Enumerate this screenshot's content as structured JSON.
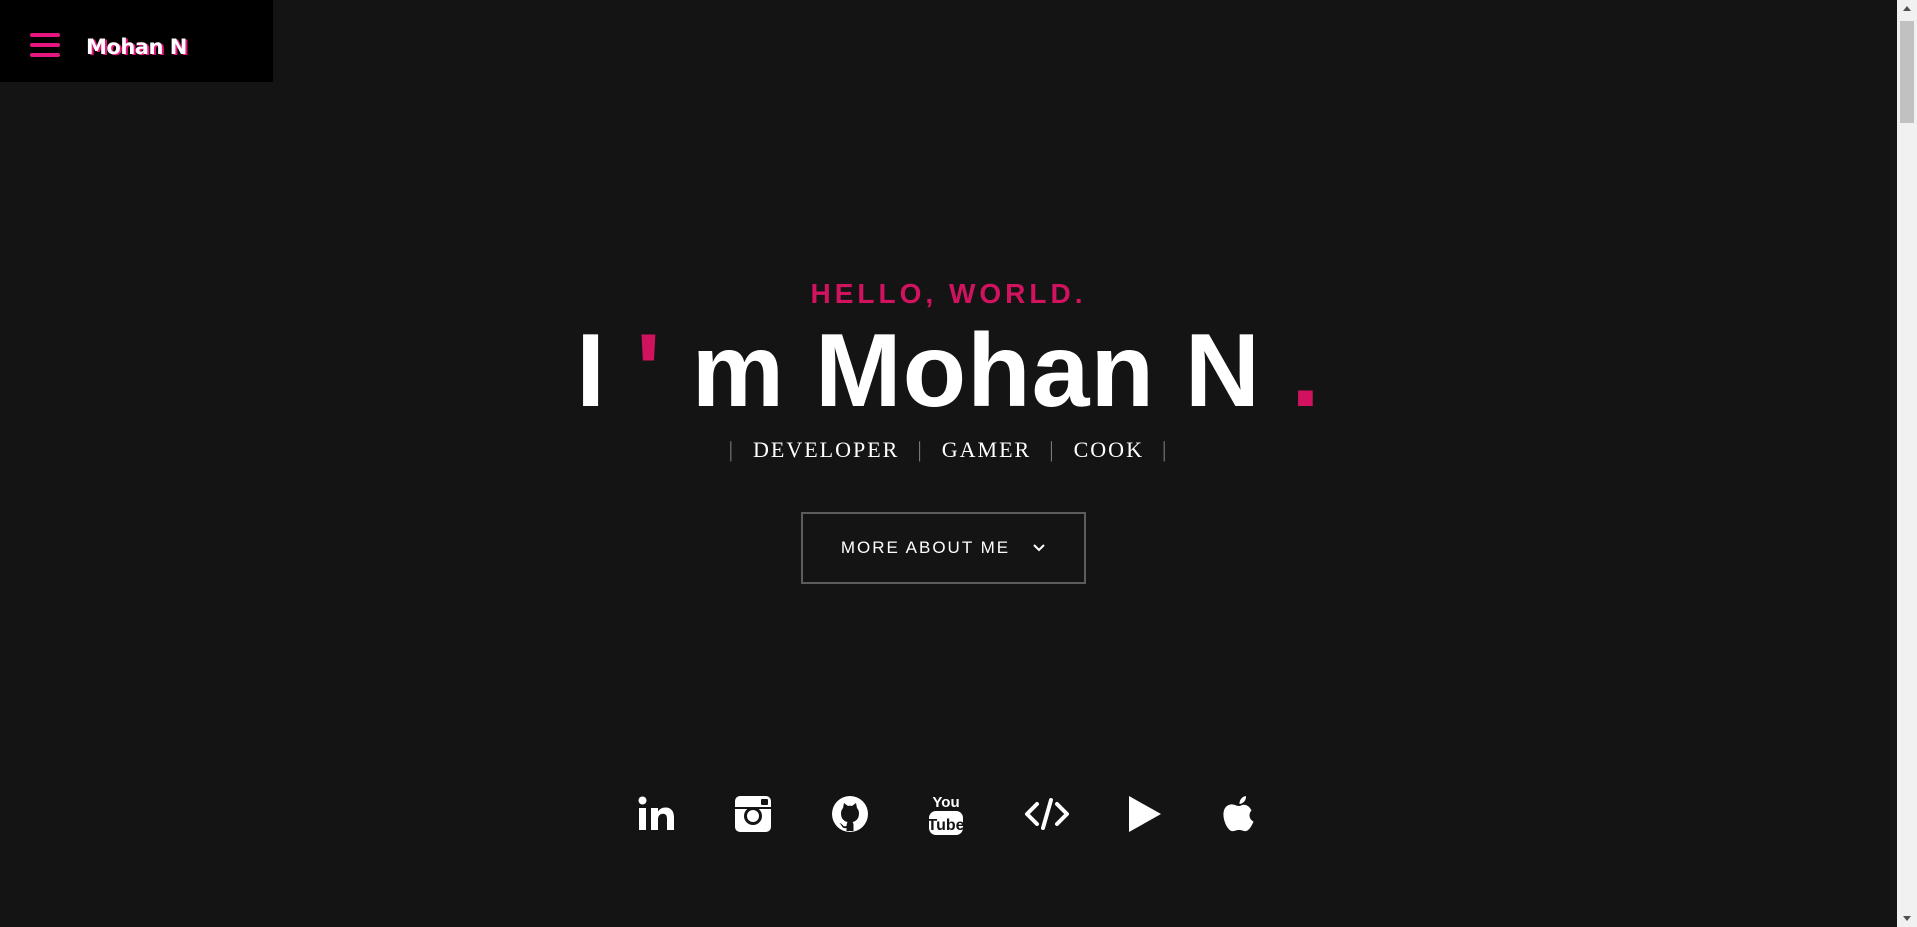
{
  "header": {
    "brand": "Mohan N",
    "menu_icon": "hamburger-menu-icon",
    "accent_color": "#e5177e"
  },
  "hero": {
    "greeting": "HELLO, WORLD.",
    "headline_i": "I",
    "headline_apostrophe": "'",
    "headline_rest": "m Mohan N",
    "headline_dot": ".",
    "roles": [
      "DEVELOPER",
      "GAMER",
      "COOK"
    ],
    "role_separator": "|",
    "cta_label": "MORE ABOUT ME",
    "cta_icon": "chevron-down-icon",
    "accent_color": "#d1125f"
  },
  "social": {
    "icons": [
      "linkedin-icon",
      "instagram-icon",
      "github-icon",
      "youtube-icon",
      "code-icon",
      "play-store-icon",
      "apple-icon"
    ]
  },
  "colors": {
    "background": "#141414",
    "header_background": "#000000",
    "text": "#ffffff"
  }
}
